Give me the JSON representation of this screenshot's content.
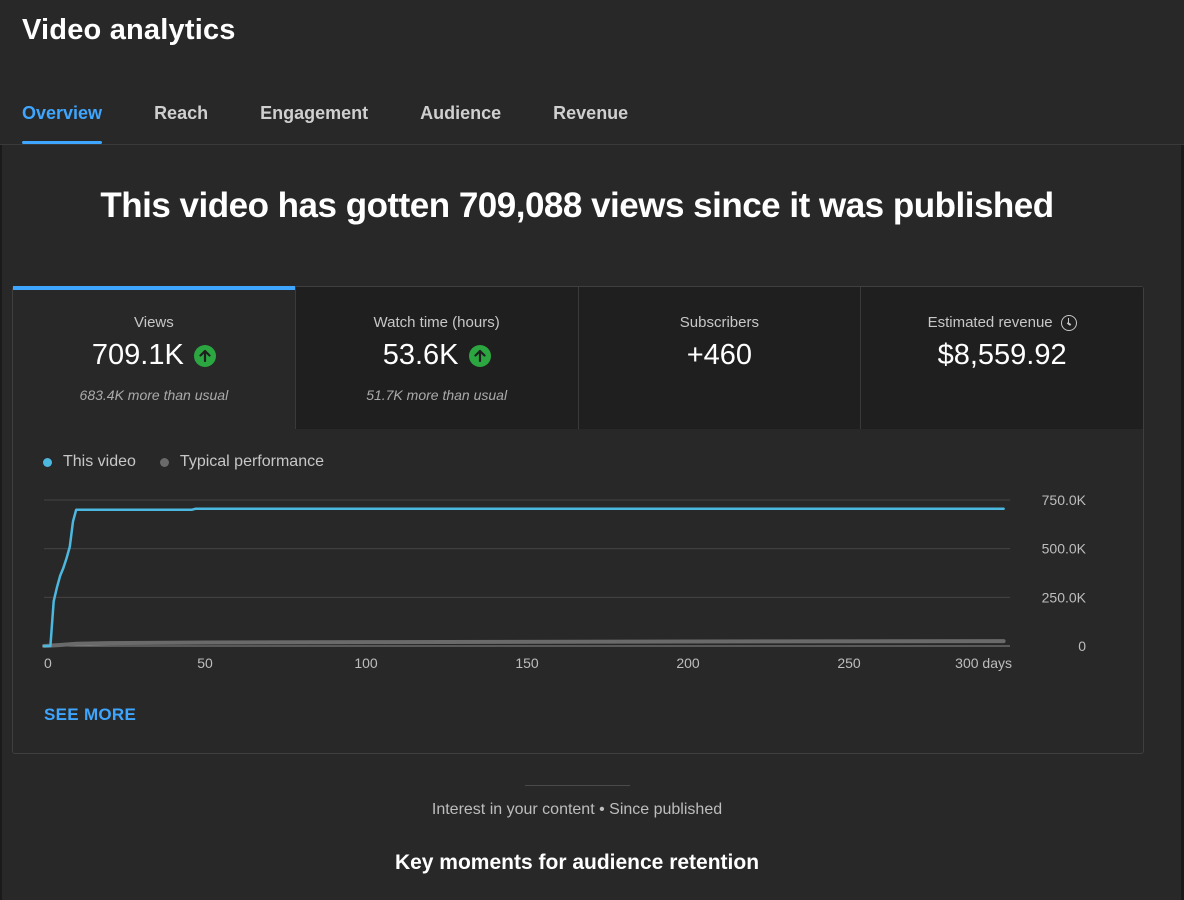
{
  "app": {
    "title": "Video analytics"
  },
  "tabs": [
    {
      "label": "Overview",
      "active": true
    },
    {
      "label": "Reach",
      "active": false
    },
    {
      "label": "Engagement",
      "active": false
    },
    {
      "label": "Audience",
      "active": false
    },
    {
      "label": "Revenue",
      "active": false
    }
  ],
  "headline": "This video has gotten 709,088 views since it was published",
  "metrics": [
    {
      "label": "Views",
      "value": "709.1K",
      "trend_icon": "arrow-up-circle-icon",
      "sub": "683.4K more than usual"
    },
    {
      "label": "Watch time (hours)",
      "value": "53.6K",
      "trend_icon": "arrow-up-circle-icon",
      "sub": "51.7K more than usual"
    },
    {
      "label": "Subscribers",
      "value": "+460",
      "sub": ""
    },
    {
      "label": "Estimated revenue",
      "value": "$8,559.92",
      "info_icon": "clock-icon",
      "sub": ""
    }
  ],
  "legend": {
    "this_video": "This video",
    "typical": "Typical performance"
  },
  "see_more": "SEE MORE",
  "interest": "Interest in your content • Since published",
  "key_moments": "Key moments for audience retention",
  "colors": {
    "accent": "#3ea6ff",
    "this_video": "#4cb8e0",
    "typical": "#6a6a6a",
    "trend_up": "#2ba640",
    "background": "#282828"
  },
  "chart_data": {
    "type": "line",
    "x_unit": "days",
    "xticks": [
      0,
      50,
      100,
      150,
      200,
      250,
      300
    ],
    "xtick_labels": [
      "0",
      "50",
      "100",
      "150",
      "200",
      "250",
      "300 days"
    ],
    "yticks": [
      0,
      250000,
      500000,
      750000
    ],
    "ytick_labels": [
      "0",
      "250.0K",
      "500.0K",
      "750.0K"
    ],
    "xlim": [
      0,
      300
    ],
    "ylim": [
      0,
      750000
    ],
    "grid": true,
    "legend_position": "top-left",
    "series": [
      {
        "name": "This video",
        "color": "#4cb8e0",
        "points": [
          [
            0,
            0
          ],
          [
            2,
            0
          ],
          [
            3,
            230000
          ],
          [
            4,
            300000
          ],
          [
            5,
            360000
          ],
          [
            6,
            400000
          ],
          [
            7,
            450000
          ],
          [
            8,
            510000
          ],
          [
            9,
            640000
          ],
          [
            10,
            700000
          ],
          [
            25,
            700000
          ],
          [
            46,
            700000
          ],
          [
            47,
            705000
          ],
          [
            100,
            705000
          ],
          [
            200,
            705000
          ],
          [
            298,
            705000
          ]
        ]
      },
      {
        "name": "Typical performance",
        "color": "#6a6a6a",
        "points": [
          [
            0,
            0
          ],
          [
            5,
            5000
          ],
          [
            10,
            12000
          ],
          [
            20,
            15000
          ],
          [
            50,
            18000
          ],
          [
            100,
            20000
          ],
          [
            200,
            23000
          ],
          [
            298,
            25000
          ]
        ]
      }
    ]
  }
}
